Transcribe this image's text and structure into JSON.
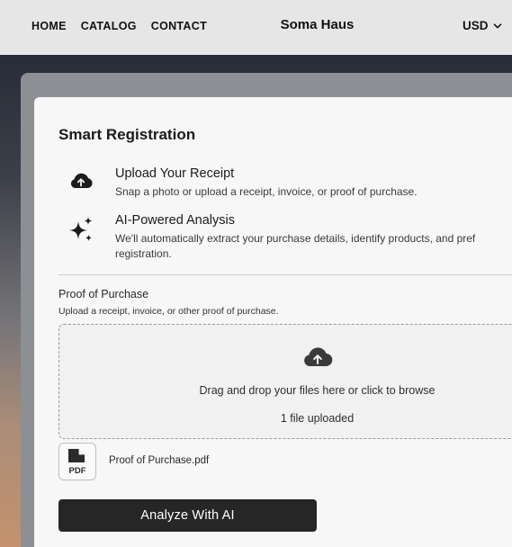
{
  "header": {
    "nav": [
      "HOME",
      "CATALOG",
      "CONTACT"
    ],
    "brand": "Soma Haus",
    "currency": "USD"
  },
  "registration": {
    "title": "Smart Registration",
    "features": [
      {
        "icon": "cloud-upload-icon",
        "heading": "Upload Your Receipt",
        "description": "Snap a photo or upload a receipt, invoice, or proof of purchase."
      },
      {
        "icon": "sparkles-icon",
        "heading": "AI-Powered Analysis",
        "description_line1": "We'll automatically extract your purchase details, identify products, and pref",
        "description_line2": "registration."
      }
    ],
    "upload": {
      "label": "Proof of Purchase",
      "sublabel": "Upload a receipt, invoice, or other proof of purchase.",
      "dropzone_text": "Drag and drop your files here or click to browse",
      "count_text": "1 file uploaded",
      "file_icon_text": "PDF",
      "file_name": "Proof of Purchase.pdf"
    },
    "analyze_label": "Analyze With AI"
  },
  "colors": {
    "header_bg": "#e6e6e6",
    "card_bg": "#f7f7f7",
    "button_bg": "#262626",
    "button_text": "#ffffff"
  }
}
